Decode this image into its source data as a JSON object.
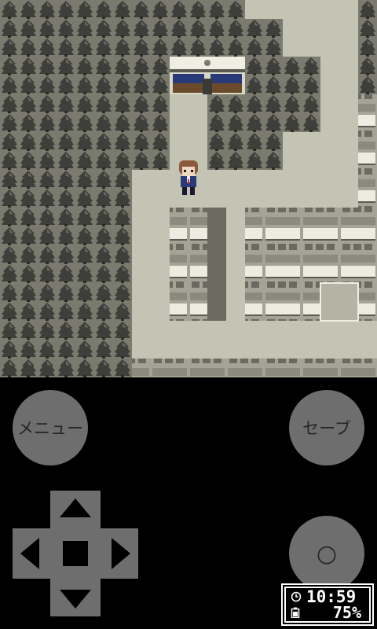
{
  "buttons": {
    "menu_label": "メニュー",
    "save_label": "セーブ",
    "confirm_label": "○"
  },
  "status": {
    "clock": "10:59",
    "battery": "75%"
  },
  "icons": {
    "dpad_up": "triangle-up",
    "dpad_down": "triangle-down",
    "dpad_left": "triangle-left",
    "dpad_right": "triangle-right",
    "clock": "clock-icon",
    "battery": "battery-icon"
  },
  "colors": {
    "button_fill": "#6e6e6e",
    "button_text": "#262626",
    "controls_bg": "#000000",
    "map_ground": "#c4c4b4",
    "tree_dark": "#4a4a44",
    "character_hair": "#8b5a3c",
    "character_coat": "#2a3a78"
  }
}
